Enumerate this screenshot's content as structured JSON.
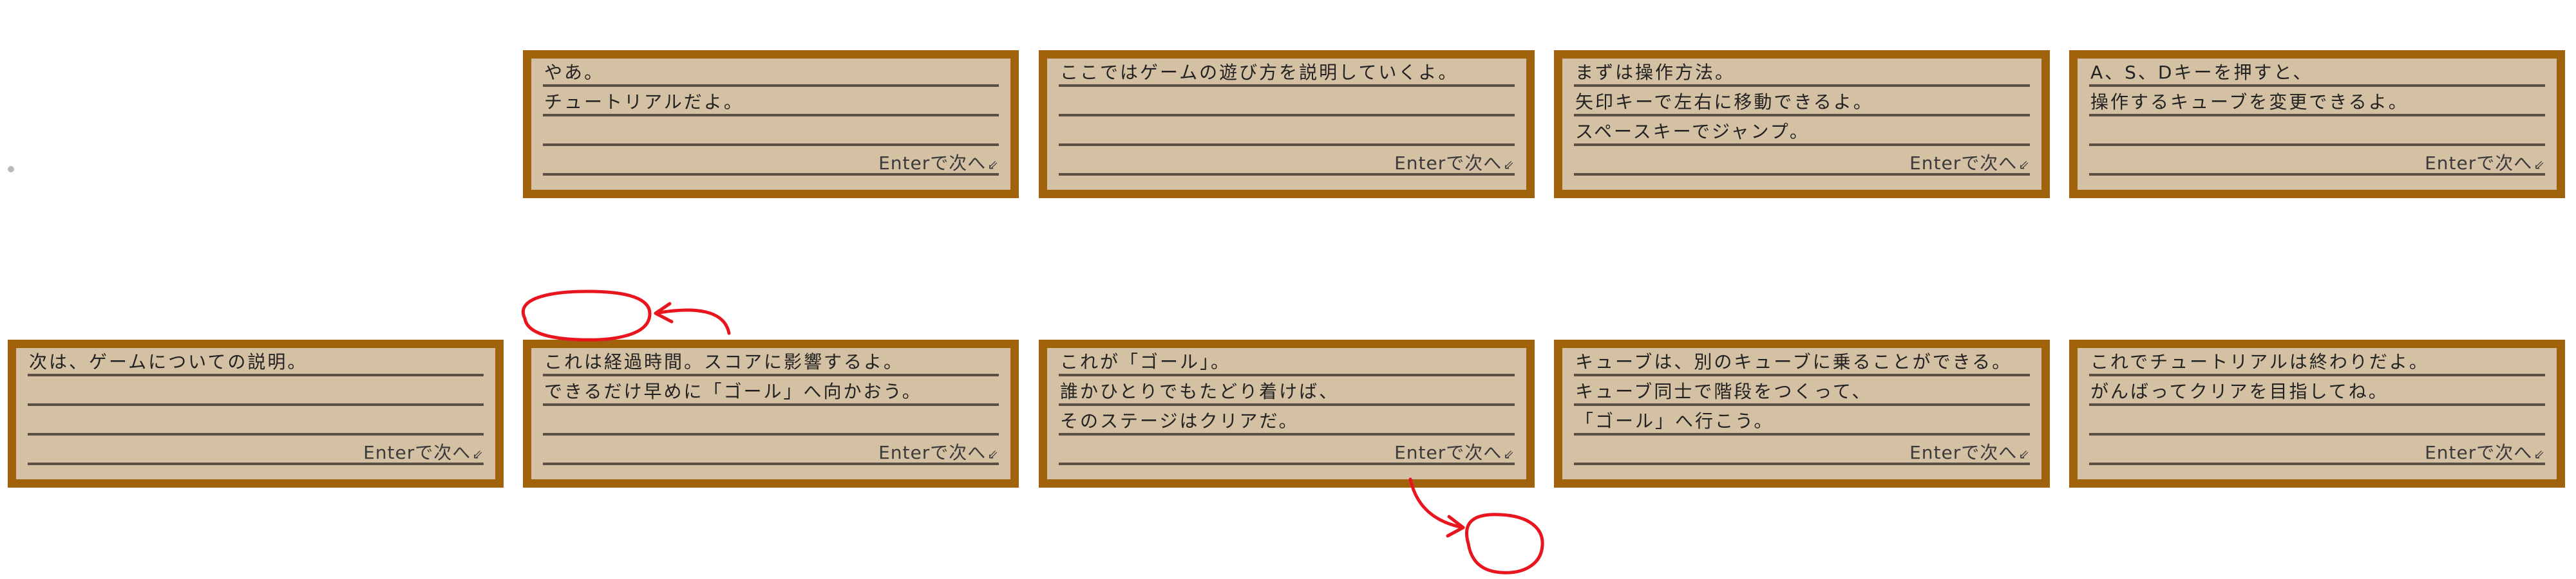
{
  "enter_hint": "Enterで次へ",
  "enter_mark": "⇙",
  "panels": [
    {
      "lines": [
        "やあ。",
        "チュートリアルだよ。",
        "",
        ""
      ]
    },
    {
      "lines": [
        "ここではゲームの遊び方を説明していくよ。",
        "",
        "",
        ""
      ]
    },
    {
      "lines": [
        "まずは操作方法。",
        "矢印キーで左右に移動できるよ。",
        "スペースキーでジャンプ。",
        ""
      ]
    },
    {
      "lines": [
        "A、S、Dキーを押すと、",
        "操作するキューブを変更できるよ。",
        "",
        ""
      ]
    },
    {
      "lines": [
        "次は、ゲームについての説明。",
        "",
        "",
        ""
      ]
    },
    {
      "lines": [
        "これは経過時間。スコアに影響するよ。",
        "できるだけ早めに「ゴール」へ向かおう。",
        "",
        ""
      ]
    },
    {
      "lines": [
        "これが「ゴール」。",
        "誰かひとりでもたどり着けば、",
        "そのステージはクリアだ。",
        ""
      ]
    },
    {
      "lines": [
        "キューブは、別のキューブに乗ることができる。",
        "キューブ同士で階段をつくって、",
        "「ゴール」へ行こう。",
        ""
      ]
    },
    {
      "lines": [
        "これでチュートリアルは終わりだよ。",
        "がんばってクリアを目指してね。",
        "",
        ""
      ]
    }
  ],
  "colors": {
    "panel_border": "#a0620a",
    "panel_bg": "#d4c0a3",
    "rule": "#5a5045",
    "annotation": "#e8141e"
  }
}
